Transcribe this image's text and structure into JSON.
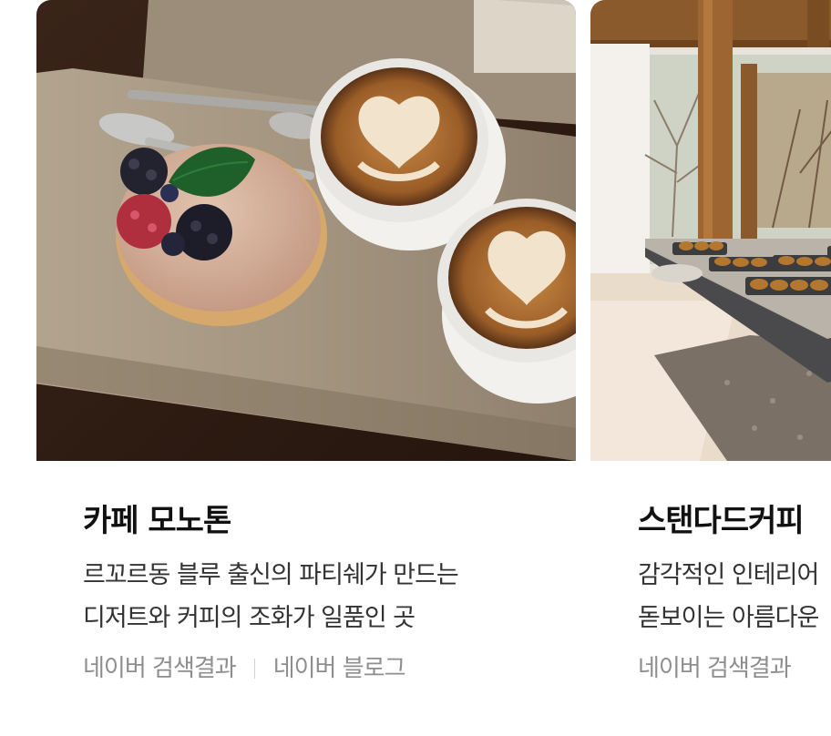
{
  "cards": [
    {
      "title": "카페 모노톤",
      "description_lines": [
        "르꼬르동 블루 출신의 파티쉐가 만드는",
        "디저트와 커피의 조화가 일품인 곳"
      ],
      "sources": [
        "네이버 검색결과",
        "네이버 블로그"
      ]
    },
    {
      "title": "스탠다드커피",
      "description_lines": [
        "감각적인 인테리어",
        "돋보이는 아름다운"
      ],
      "sources": [
        "네이버 검색결과"
      ]
    }
  ]
}
